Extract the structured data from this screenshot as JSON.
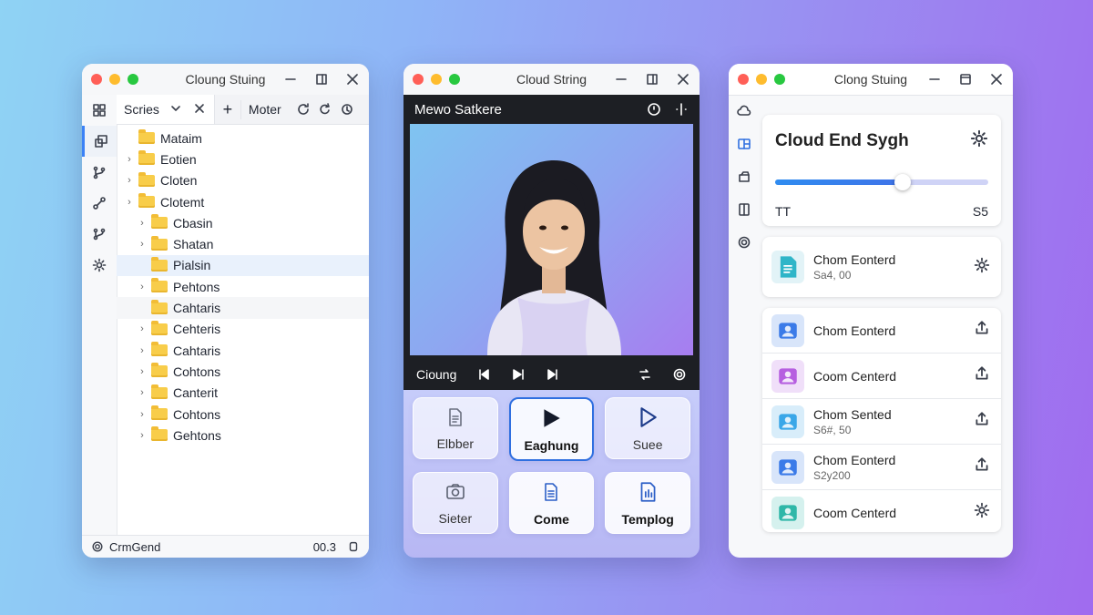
{
  "window1": {
    "title": "Cloung Stuing",
    "tabs": {
      "active_label": "Scries",
      "more_label": "Moter"
    },
    "tree": [
      {
        "label": "Mataim",
        "level": 0,
        "chevron": false
      },
      {
        "label": "Eotien",
        "level": 0,
        "chevron": true
      },
      {
        "label": "Cloten",
        "level": 0,
        "chevron": true
      },
      {
        "label": "Clotemt",
        "level": 0,
        "chevron": true
      },
      {
        "label": "Cbasin",
        "level": 1,
        "chevron": true
      },
      {
        "label": "Shatan",
        "level": 1,
        "chevron": true
      },
      {
        "label": "Pialsin",
        "level": 1,
        "chevron": false,
        "selected": true
      },
      {
        "label": "Pehtons",
        "level": 1,
        "chevron": true
      },
      {
        "label": "Cahtaris",
        "level": 1,
        "chevron": false,
        "hover": true
      },
      {
        "label": "Cehteris",
        "level": 1,
        "chevron": true
      },
      {
        "label": "Cahtaris",
        "level": 1,
        "chevron": true
      },
      {
        "label": "Cohtons",
        "level": 1,
        "chevron": true
      },
      {
        "label": "Canterit",
        "level": 1,
        "chevron": true
      },
      {
        "label": "Cohtons",
        "level": 1,
        "chevron": true
      },
      {
        "label": "Gehtons",
        "level": 1,
        "chevron": true
      }
    ],
    "status": {
      "label": "CrmGend",
      "value": "00.3"
    }
  },
  "window2": {
    "title": "Cloud String",
    "media_title": "Mewo Satkere",
    "control_label": "Cioung",
    "tiles": [
      {
        "label": "Elbber",
        "icon": "document-icon",
        "state": "normal"
      },
      {
        "label": "Eaghung",
        "icon": "play-icon",
        "state": "active"
      },
      {
        "label": "Suee",
        "icon": "play-outline-icon",
        "state": "normal"
      },
      {
        "label": "Sieter",
        "icon": "camera-icon",
        "state": "normal"
      },
      {
        "label": "Come",
        "icon": "file-icon",
        "state": "bold"
      },
      {
        "label": "Templog",
        "icon": "chart-icon",
        "state": "bold"
      }
    ]
  },
  "window3": {
    "title": "Clong Stuing",
    "card": {
      "heading": "Cloud End Sygh",
      "slider_value": 0.6,
      "left_label": "TT",
      "right_label": "S5"
    },
    "featured": {
      "title": "Chom Eonterd",
      "subtitle": "Sa4, 00"
    },
    "items": [
      {
        "title": "Chom Eonterd",
        "subtitle": "",
        "thumb_color": "#3b7be8",
        "action": "upload-icon"
      },
      {
        "title": "Coom Centerd",
        "subtitle": "",
        "thumb_color": "#b65fe0",
        "action": "upload-icon"
      },
      {
        "title": "Chom Sented",
        "subtitle": "S6#, 50",
        "thumb_color": "#3aa7e8",
        "action": "upload-icon"
      },
      {
        "title": "Chom Eonterd",
        "subtitle": "S2y200",
        "thumb_color": "#3b7be8",
        "action": "upload-icon"
      },
      {
        "title": "Coom Centerd",
        "subtitle": "",
        "thumb_color": "#2fb7a8",
        "action": "gear-icon"
      }
    ]
  }
}
